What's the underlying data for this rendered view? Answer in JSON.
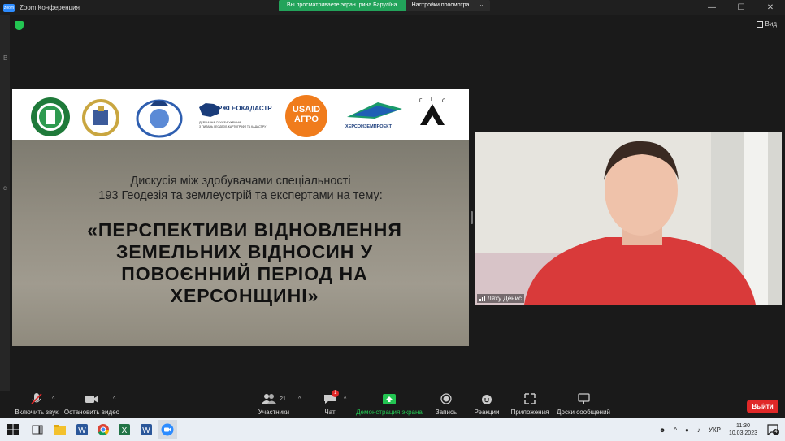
{
  "window": {
    "title": "Zoom Конференция",
    "zoom_badge": "zoom"
  },
  "share_banner": {
    "viewing_text": "Вы просматриваете экран Ірина Барулїна",
    "settings_label": "Настройки просмотра"
  },
  "view_button": {
    "label": "Вид"
  },
  "left_strip_chars": [
    "В",
    "с"
  ],
  "slide": {
    "logos": {
      "usaid_line1": "USAID",
      "usaid_line2": "АГРО",
      "derzh_title": "ДЕРЖГЕОКАДАСТР",
      "derzh_sub1": "ДЕРЖАВНА СЛУЖБА УКРАЇНИ",
      "derzh_sub2": "З ПИТАНЬ ГЕОДЕЗІЇ, КАРТОГРАФІЇ ТА КАДАСТРУ",
      "kherson_proekt": "ХЕРСОНЗЕМПРОЕКТ",
      "gis_g": "Г",
      "gis_i": "І",
      "gis_s": "С"
    },
    "intro_line1": "Дискусія між здобувачами спеціальності",
    "intro_line2": "193 Геодезія та землеустрій та експертами на тему:",
    "headline_line1": "«ПЕРСПЕКТИВИ ВІДНОВЛЕННЯ",
    "headline_line2": "ЗЕМЕЛЬНИХ ВІДНОСИН У",
    "headline_line3": "ПОВОЄННИЙ ПЕРІОД НА",
    "headline_line4": "ХЕРСОНЩИНІ»"
  },
  "camera": {
    "participant_name": "Ляху Денис"
  },
  "toolbar": {
    "mute_label": "Включить звук",
    "video_label": "Остановить видео",
    "participants_label": "Участники",
    "participants_count": "21",
    "chat_label": "Чат",
    "chat_badge": "1",
    "share_label": "Демонстрация экрана",
    "record_label": "Запись",
    "reactions_label": "Реакции",
    "apps_label": "Приложения",
    "whiteboard_label": "Доски сообщений",
    "leave_label": "Выйти"
  },
  "taskbar": {
    "language": "УКР",
    "time": "11:30",
    "date": "10.03.2023",
    "notifications": "4"
  },
  "colors": {
    "share_green": "#22a35a",
    "leave_red": "#e02828",
    "zoom_blue": "#2d8cff"
  }
}
